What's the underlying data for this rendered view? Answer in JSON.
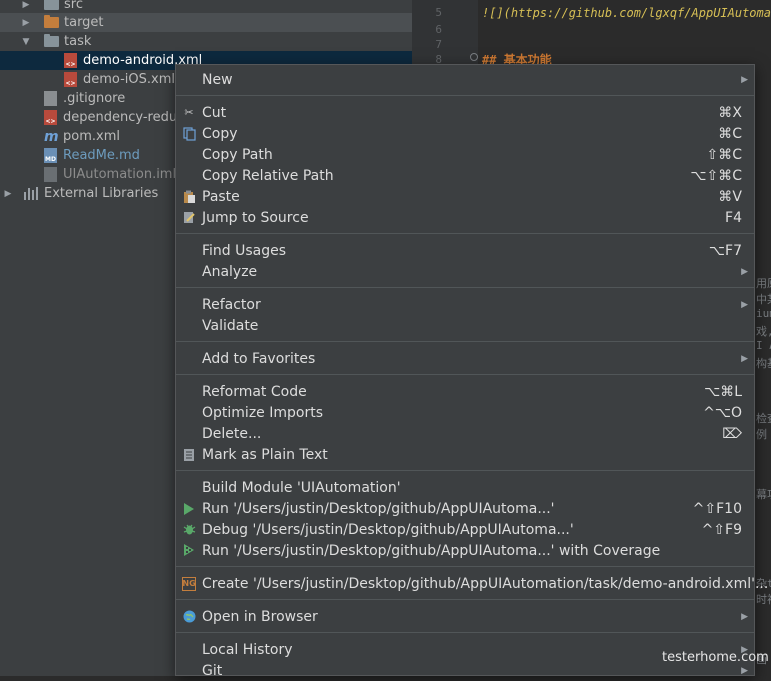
{
  "project_tree": {
    "items": [
      {
        "label": "src"
      },
      {
        "label": "target"
      },
      {
        "label": "task"
      },
      {
        "label": "demo-android.xml"
      },
      {
        "label": "demo-iOS.xml"
      },
      {
        "label": ".gitignore"
      },
      {
        "label": "dependency-reduc"
      },
      {
        "label": "pom.xml"
      },
      {
        "label": "ReadMe.md"
      },
      {
        "label": "UIAutomation.iml"
      },
      {
        "label": "External Libraries"
      }
    ]
  },
  "editor": {
    "line_numbers": [
      "5",
      "6",
      "7",
      "8"
    ],
    "url_line": "![](https://github.com/lgxqf/AppUIAutomat",
    "heading_line": "## 基本功能",
    "right_fragments": [
      "用原",
      "中某",
      "ium",
      "戏,",
      "I An",
      "构基",
      "检查",
      "例",
      "幕功",
      "杂t",
      "时视",
      "画"
    ]
  },
  "context_menu": {
    "items": [
      {
        "label": "New",
        "shortcut": "",
        "icon": ""
      },
      {
        "label": "Cut",
        "shortcut": "⌘X",
        "icon": "scissors-icon"
      },
      {
        "label": "Copy",
        "shortcut": "⌘C",
        "icon": "copy-icon"
      },
      {
        "label": "Copy Path",
        "shortcut": "⇧⌘C",
        "icon": ""
      },
      {
        "label": "Copy Relative Path",
        "shortcut": "⌥⇧⌘C",
        "icon": ""
      },
      {
        "label": "Paste",
        "shortcut": "⌘V",
        "icon": "paste-icon"
      },
      {
        "label": "Jump to Source",
        "shortcut": "F4",
        "icon": "jump-icon"
      },
      {
        "label": "Find Usages",
        "shortcut": "⌥F7",
        "icon": ""
      },
      {
        "label": "Analyze",
        "shortcut": "",
        "icon": ""
      },
      {
        "label": "Refactor",
        "shortcut": "",
        "icon": ""
      },
      {
        "label": "Validate",
        "shortcut": "",
        "icon": ""
      },
      {
        "label": "Add to Favorites",
        "shortcut": "",
        "icon": ""
      },
      {
        "label": "Reformat Code",
        "shortcut": "⌥⌘L",
        "icon": ""
      },
      {
        "label": "Optimize Imports",
        "shortcut": "^⌥O",
        "icon": ""
      },
      {
        "label": "Delete...",
        "shortcut": "⌦",
        "icon": ""
      },
      {
        "label": "Mark as Plain Text",
        "shortcut": "",
        "icon": "plain-text-icon"
      },
      {
        "label": "Build Module 'UIAutomation'",
        "shortcut": "",
        "icon": ""
      },
      {
        "label": "Run '/Users/justin/Desktop/github/AppUIAutoma...'",
        "shortcut": "^⇧F10",
        "icon": "run-icon"
      },
      {
        "label": "Debug '/Users/justin/Desktop/github/AppUIAutoma...'",
        "shortcut": "^⇧F9",
        "icon": "debug-icon"
      },
      {
        "label": "Run '/Users/justin/Desktop/github/AppUIAutoma...' with Coverage",
        "shortcut": "",
        "icon": "coverage-icon"
      },
      {
        "label": "Create '/Users/justin/Desktop/github/AppUIAutomation/task/demo-android.xml'...",
        "shortcut": "",
        "icon": "testng-icon"
      },
      {
        "label": "Open in Browser",
        "shortcut": "",
        "icon": "browser-icon"
      },
      {
        "label": "Local History",
        "shortcut": "",
        "icon": ""
      },
      {
        "label": "Git",
        "shortcut": "",
        "icon": ""
      }
    ]
  },
  "watermark": "testerhome.com"
}
